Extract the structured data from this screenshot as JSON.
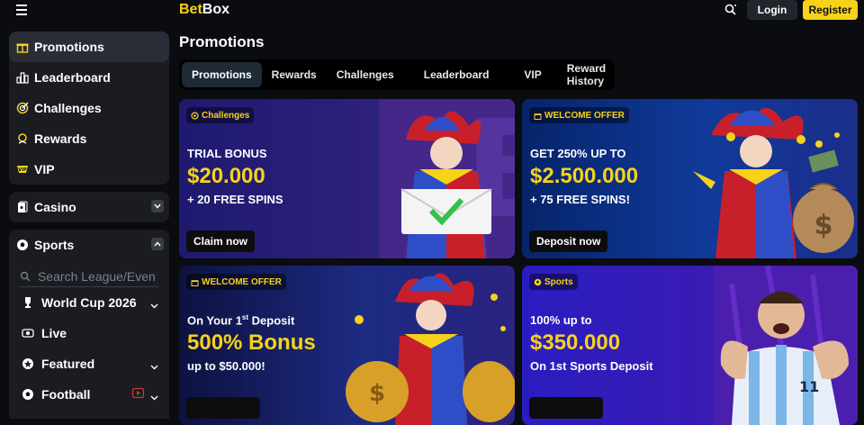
{
  "header": {
    "logo_bet": "Bet",
    "logo_box": "Box",
    "login_label": "Login",
    "register_label": "Register"
  },
  "sidebar": {
    "items": [
      {
        "label": "Promotions",
        "icon": "gift-icon"
      },
      {
        "label": "Leaderboard",
        "icon": "leaderboard-icon"
      },
      {
        "label": "Challenges",
        "icon": "target-icon"
      },
      {
        "label": "Rewards",
        "icon": "rewards-icon"
      },
      {
        "label": "VIP",
        "icon": "vip-icon"
      }
    ],
    "casino_label": "Casino",
    "sports_label": "Sports",
    "search_placeholder": "Search League/Even",
    "sports_items": [
      {
        "label": "World Cup 2026",
        "icon": "trophy-icon"
      },
      {
        "label": "Live",
        "icon": "live-icon"
      },
      {
        "label": "Featured",
        "icon": "featured-icon"
      },
      {
        "label": "Football",
        "icon": "football-icon"
      }
    ]
  },
  "main": {
    "title": "Promotions",
    "tabs": [
      "Promotions",
      "Rewards",
      "Challenges",
      "Leaderboard",
      "VIP",
      "Reward History"
    ],
    "cards": [
      {
        "badge": "Challenges",
        "line1": "TRIAL BONUS",
        "big": "$20.000",
        "line3": "+ 20 FREE SPINS",
        "cta": "Claim now"
      },
      {
        "badge": "WELCOME OFFER",
        "line1": "GET 250% UP TO",
        "big": "$2.500.000",
        "line3": "+ 75 FREE SPINS!",
        "cta": "Deposit now"
      },
      {
        "badge": "WELCOME OFFER",
        "line1_pre": "On Your 1",
        "line1_sup": "st",
        "line1_post": " Deposit",
        "big": "500% Bonus",
        "line3": "up to $50.000!",
        "cta": ""
      },
      {
        "badge": "Sports",
        "line1": "100% up to",
        "big": "$350.000",
        "line3": "On 1st Sports Deposit",
        "cta": ""
      }
    ]
  },
  "colors": {
    "accent": "#f7d21b",
    "background": "#0b0c10",
    "panel": "#1a1c22"
  }
}
